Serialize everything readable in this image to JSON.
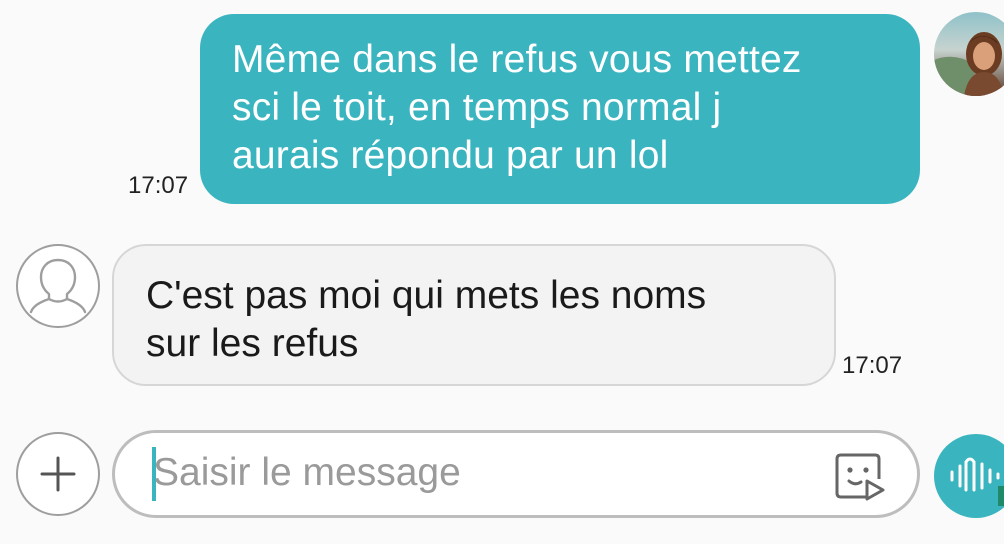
{
  "conversation": {
    "messages": [
      {
        "direction": "outgoing",
        "lines": [
          "Même dans le refus vous mettez",
          "sci le toit,  en temps normal j",
          "aurais répondu par un lol"
        ],
        "time": "17:07"
      },
      {
        "direction": "incoming",
        "lines": [
          "C'est pas moi qui mets les noms",
          "sur les refus"
        ],
        "time": "17:07"
      }
    ]
  },
  "composer": {
    "placeholder": "Saisir le message",
    "value": "",
    "add_icon": "plus-icon",
    "sticker_icon": "sticker-icon",
    "voice_icon": "voice-wave-icon"
  },
  "colors": {
    "accent": "#3ab5c0",
    "incoming_bubble": "#f3f3f3",
    "background": "#fafafa"
  }
}
